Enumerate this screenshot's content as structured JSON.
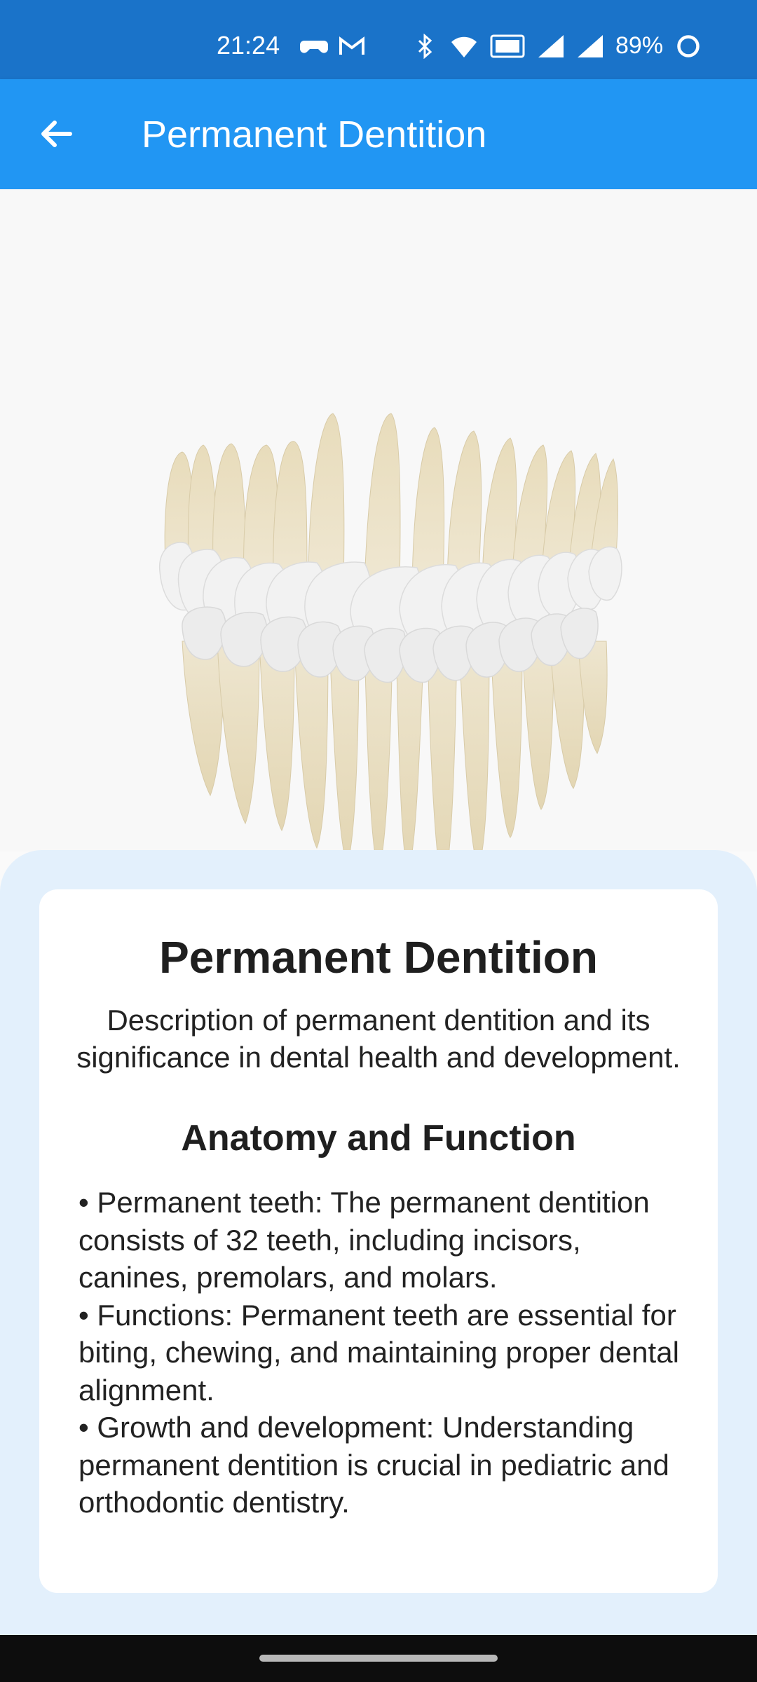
{
  "status_bar": {
    "time": "21:24",
    "battery": "89%",
    "icons": [
      "game-controller-icon",
      "gmail-icon",
      "bluetooth-icon",
      "wifi-icon",
      "vowifi-icon",
      "signal-icon",
      "signal-icon",
      "battery-ring-icon"
    ]
  },
  "app_bar": {
    "title": "Permanent Dentition",
    "back_icon": "arrow-back-icon",
    "color": "#2196f3"
  },
  "model_view": {
    "ar_icon": "ar-cube-icon"
  },
  "card": {
    "title": "Permanent Dentition",
    "description": "Description of permanent dentition and its significance in dental health and development.",
    "subtitle": "Anatomy and Function",
    "bullets": [
      "• Permanent teeth: The permanent dentition consists of 32 teeth, including incisors, canines, premolars, and molars.",
      "• Functions: Permanent teeth are essential for biting, chewing, and maintaining proper dental alignment.",
      "• Growth and development: Understanding permanent dentition is crucial in pediatric and orthodontic dentistry."
    ]
  }
}
